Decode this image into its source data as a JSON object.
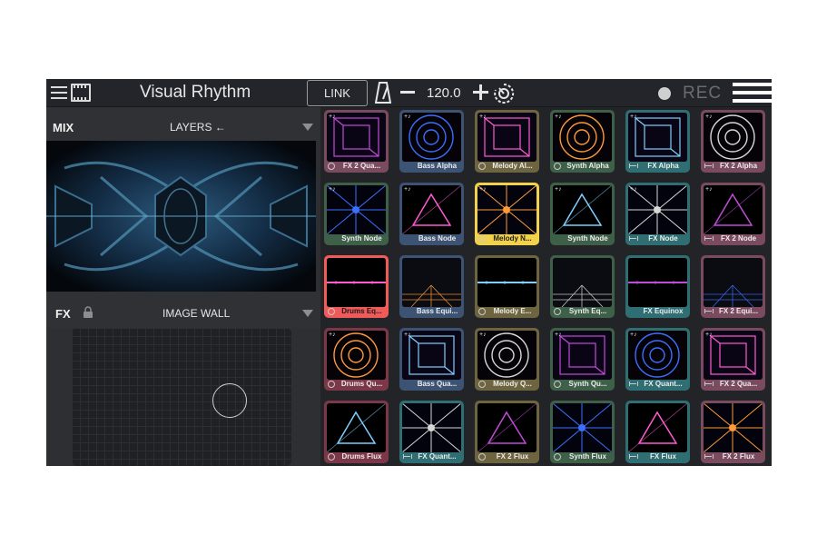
{
  "app": {
    "title": "Visual Rhythm",
    "link_label": "LINK",
    "tempo": "120.0",
    "rec_label": "REC"
  },
  "left": {
    "mix_label": "MIX",
    "layers_label": "LAYERS ←",
    "fx_label": "FX",
    "image_wall_label": "IMAGE WALL"
  },
  "clips": [
    {
      "name": "FX 2 Qua...",
      "group": "fx2",
      "mode": "circle"
    },
    {
      "name": "Bass Alpha",
      "group": "bass",
      "mode": "none"
    },
    {
      "name": "Melody Al...",
      "group": "melody",
      "mode": "circle"
    },
    {
      "name": "Synth Alpha",
      "group": "synth",
      "mode": "circle"
    },
    {
      "name": "FX Alpha",
      "group": "fx",
      "mode": "bar"
    },
    {
      "name": "FX 2 Alpha",
      "group": "fx2",
      "mode": "bar"
    },
    {
      "name": "Synth Node",
      "group": "synth",
      "mode": "none"
    },
    {
      "name": "Bass Node",
      "group": "bass",
      "mode": "none"
    },
    {
      "name": "Melody N...",
      "group": "melody",
      "mode": "circle",
      "state": "active-yellow"
    },
    {
      "name": "Synth Node",
      "group": "synth",
      "mode": "none"
    },
    {
      "name": "FX Node",
      "group": "fx",
      "mode": "bar"
    },
    {
      "name": "FX 2 Node",
      "group": "fx2",
      "mode": "bar"
    },
    {
      "name": "Drums Eq...",
      "group": "drums",
      "mode": "circle",
      "state": "active-red"
    },
    {
      "name": "Bass Equi...",
      "group": "bass",
      "mode": "none"
    },
    {
      "name": "Melody E...",
      "group": "melody",
      "mode": "circle"
    },
    {
      "name": "Synth Eq...",
      "group": "synth",
      "mode": "circle"
    },
    {
      "name": "FX Equinox",
      "group": "fx",
      "mode": "none"
    },
    {
      "name": "FX 2 Equi...",
      "group": "fx2",
      "mode": "bar"
    },
    {
      "name": "Drums Qu...",
      "group": "drums",
      "mode": "circle"
    },
    {
      "name": "Bass Qua...",
      "group": "bass",
      "mode": "none"
    },
    {
      "name": "Melody Q...",
      "group": "melody",
      "mode": "circle"
    },
    {
      "name": "Synth Qu...",
      "group": "synth",
      "mode": "circle"
    },
    {
      "name": "FX Quant...",
      "group": "fx",
      "mode": "bar"
    },
    {
      "name": "FX 2 Qua...",
      "group": "fx2",
      "mode": "bar"
    },
    {
      "name": "Drums Flux",
      "group": "drums",
      "mode": "circle"
    },
    {
      "name": "FX Quant...",
      "group": "fx",
      "mode": "bar"
    },
    {
      "name": "FX 2 Flux",
      "group": "melody",
      "mode": "circle"
    },
    {
      "name": "Synth Flux",
      "group": "synth",
      "mode": "circle"
    },
    {
      "name": "FX Flux",
      "group": "fx",
      "mode": "bar"
    },
    {
      "name": "FX 2 Flux",
      "group": "fx2",
      "mode": "bar"
    }
  ],
  "colors": {
    "drums": "#7c3848",
    "bass": "#3c5374",
    "melody": "#6e6540",
    "synth": "#3e6048",
    "fx": "#2f6e72",
    "fx2": "#7a4a5e",
    "active_yellow": "#f2d24a",
    "active_red": "#f05a5a"
  }
}
